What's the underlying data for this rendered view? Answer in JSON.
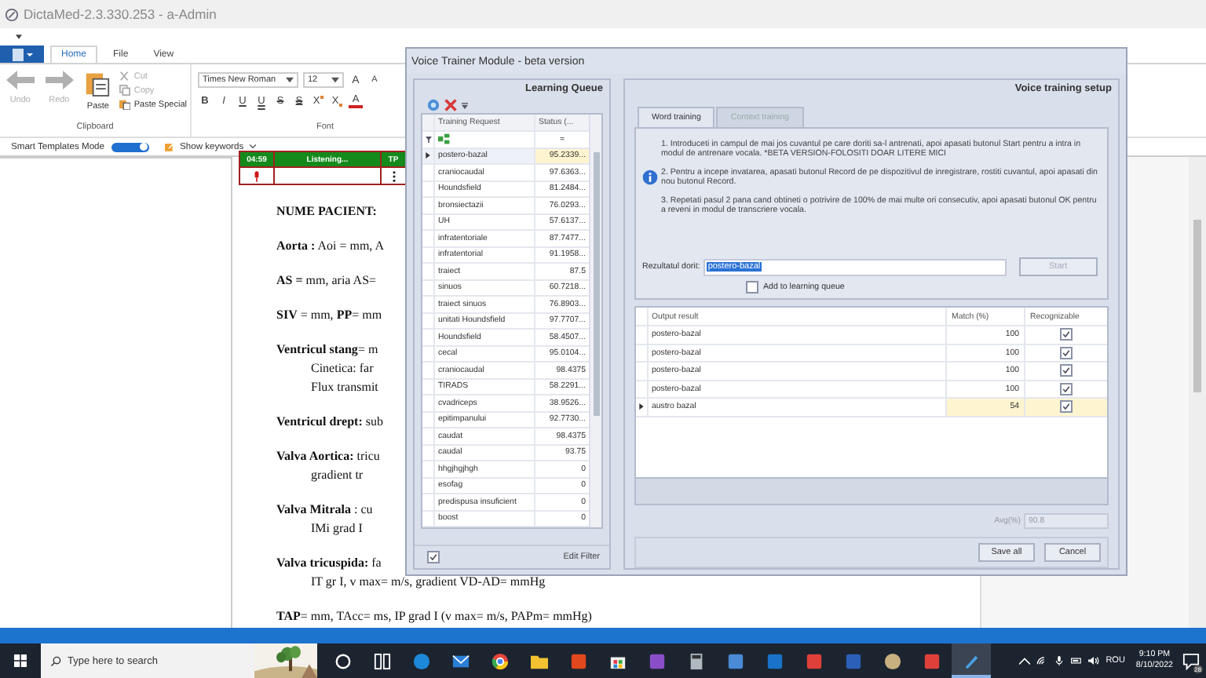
{
  "app_window": {
    "title": "DictaMed-2.3.330.253 - a-Admin"
  },
  "ribbon": {
    "tabs": [
      {
        "label": "Home",
        "selected": true
      },
      {
        "label": "File",
        "selected": false
      },
      {
        "label": "View",
        "selected": false
      }
    ],
    "clipboard": {
      "large_buttons": [
        {
          "label": "Undo",
          "kind": "undo",
          "disabled": true
        },
        {
          "label": "Redo",
          "kind": "redo",
          "disabled": true
        },
        {
          "label": "Paste",
          "kind": "paste",
          "disabled": false
        }
      ],
      "small_buttons": [
        {
          "label": "Cut",
          "kind": "cut",
          "disabled": true
        },
        {
          "label": "Copy",
          "kind": "copy",
          "disabled": true
        },
        {
          "label": "Paste Special",
          "kind": "paste",
          "disabled": false
        }
      ],
      "group_label": "Clipboard"
    },
    "font": {
      "family": "Times New Roman",
      "size": "12",
      "grow": "A",
      "shrink": "A",
      "format_buttons": [
        {
          "label": "B",
          "kind": "bold"
        },
        {
          "label": "I",
          "kind": "italic"
        },
        {
          "label": "U",
          "kind": "underline"
        },
        {
          "label": "U",
          "kind": "double-underline"
        },
        {
          "label": "S",
          "kind": "strike"
        },
        {
          "label": "S",
          "kind": "double-strike"
        },
        {
          "label": "X",
          "kind": "superscript"
        },
        {
          "label": "X",
          "kind": "subscript"
        },
        {
          "label": "A",
          "kind": "color"
        }
      ],
      "group_label": "Font"
    }
  },
  "smart_templates": {
    "label": "Smart Templates Mode",
    "on": true
  },
  "show_keywords": "Show keywords",
  "listening_bar": {
    "timer": "04:59",
    "status": "Listening...",
    "mode": "TP"
  },
  "document": {
    "paragraphs": [
      {
        "text": "**NUME PACIENT:**"
      },
      {
        "text": "**Aorta :** Aoi = mm, A"
      },
      {
        "text": "**AS =**  mm, aria AS="
      },
      {
        "text": "**SIV** = mm, **PP**= mm"
      },
      {
        "text": "**Ventricul stang**= m",
        "children": [
          {
            "text": "Cinetica: far"
          },
          {
            "text": "Flux transmit"
          }
        ]
      },
      {
        "text": "**Ventricul drept:** sub"
      },
      {
        "text": "**Valva Aortica:** tricu",
        "children": [
          {
            "text": "gradient tr"
          }
        ]
      },
      {
        "text": "**Valva Mitrala** :  cu",
        "children": [
          {
            "text": "IMi grad I"
          }
        ]
      },
      {
        "text": "**Valva tricuspida:** fa",
        "children": [
          {
            "text": "IT gr I, v max= m/s, gradient VD-AD= mmHg"
          }
        ]
      },
      {
        "text": "**TAP**= mm, TAcc=  ms, IP grad I (v max= m/s, PAPm= mmHg)"
      }
    ]
  },
  "dialog": {
    "title": "Voice Trainer Module - beta version",
    "learning_queue": {
      "title": "Learning Queue",
      "columns": [
        "Training Request",
        "Status (..."
      ],
      "filter": "=",
      "rows": [
        {
          "request": "postero-bazal",
          "status": "95.2339...",
          "selected": true
        },
        {
          "request": "craniocaudal",
          "status": "97.6363...",
          "selected": false
        },
        {
          "request": "Houndsfield",
          "status": "81.2484...",
          "selected": false
        },
        {
          "request": "bronsiectazii",
          "status": "76.0293...",
          "selected": false
        },
        {
          "request": "UH",
          "status": "57.6137...",
          "selected": false
        },
        {
          "request": "infratentoriale",
          "status": "87.7477...",
          "selected": false
        },
        {
          "request": "infratentorial",
          "status": "91.1958...",
          "selected": false
        },
        {
          "request": "traiect",
          "status": "87.5",
          "selected": false
        },
        {
          "request": "sinuos",
          "status": "60.7218...",
          "selected": false
        },
        {
          "request": "traiect sinuos",
          "status": "76.8903...",
          "selected": false
        },
        {
          "request": "unitati Houndsfield",
          "status": "97.7707...",
          "selected": false
        },
        {
          "request": "Houndsfield",
          "status": "58.4507...",
          "selected": false
        },
        {
          "request": "cecal",
          "status": "95.0104...",
          "selected": false
        },
        {
          "request": "craniocaudal",
          "status": "98.4375",
          "selected": false
        },
        {
          "request": "TIRADS",
          "status": "58.2291...",
          "selected": false
        },
        {
          "request": "cvadriceps",
          "status": "38.9526...",
          "selected": false
        },
        {
          "request": "epitimpanului",
          "status": "92.7730...",
          "selected": false
        },
        {
          "request": "caudat",
          "status": "98.4375",
          "selected": false
        },
        {
          "request": "caudal",
          "status": "93.75",
          "selected": false
        },
        {
          "request": "hhgjhgjhgh",
          "status": "0",
          "selected": false
        },
        {
          "request": "esofag",
          "status": "0",
          "selected": false
        },
        {
          "request": "predispusa insuficient",
          "status": "0",
          "selected": false
        },
        {
          "request": "boost",
          "status": "0",
          "selected": false
        }
      ],
      "filter_enabled": {
        "checked": true
      },
      "edit_filter": "Edit Filter"
    },
    "setup": {
      "title": "Voice training setup",
      "tabs": [
        {
          "label": "Word training",
          "selected": true
        },
        {
          "label": "Context training",
          "selected": false
        }
      ],
      "instructions": [
        "1. Introduceti in campul de mai jos cuvantul pe care doriti sa-l antrenati, apoi apasati butonul Start pentru a intra in modul de antrenare vocala. *BETA VERSION-FOLOSITI DOAR LITERE MICI",
        "2. Pentru a incepe invatarea, apasati butonul Record de pe dispozitivul de inregistrare, rostiti cuvantul, apoi apasati din nou butonul Record.",
        "3. Repetati pasul 2 pana cand obtineti o potrivire de 100% de mai multe ori consecutiv, apoi apasati butonul OK pentru a reveni in modul de transcriere vocala."
      ],
      "desired_result": {
        "label": "Rezultatul dorit:",
        "value": "postero-bazal"
      },
      "start_button": {
        "label": "Start",
        "disabled": true
      },
      "add_to_queue": {
        "label": "Add to learning queue",
        "checked": false
      },
      "results": {
        "columns": [
          "Output result",
          "Match (%)",
          "Recognizable"
        ],
        "rows": [
          {
            "output": "postero-bazal",
            "match": "100",
            "recognizable": true,
            "selected": false
          },
          {
            "output": "postero-bazal",
            "match": "100",
            "recognizable": true,
            "selected": false
          },
          {
            "output": "postero-bazal",
            "match": "100",
            "recognizable": true,
            "selected": false
          },
          {
            "output": "postero-bazal",
            "match": "100",
            "recognizable": true,
            "selected": false
          },
          {
            "output": "austro bazal",
            "match": "54",
            "recognizable": true,
            "selected": true
          }
        ]
      },
      "average": {
        "label": "Avg(%)",
        "value": "90.8"
      },
      "buttons": [
        "Save all",
        "Cancel"
      ]
    }
  },
  "taskbar": {
    "search": {
      "placeholder": "Type here to search"
    },
    "apps": [
      {
        "selected": false
      },
      {
        "selected": false
      },
      {
        "selected": false
      },
      {
        "selected": false
      },
      {
        "selected": false
      },
      {
        "selected": false
      },
      {
        "selected": false
      },
      {
        "selected": false
      },
      {
        "selected": false
      },
      {
        "selected": false
      },
      {
        "selected": false
      },
      {
        "selected": false
      },
      {
        "selected": false
      },
      {
        "selected": false
      },
      {
        "selected": false
      },
      {
        "selected": false
      },
      {
        "selected": true
      }
    ],
    "language": "ROU",
    "time": "9:10 PM",
    "date": "8/10/2022",
    "notification_count": "28"
  }
}
